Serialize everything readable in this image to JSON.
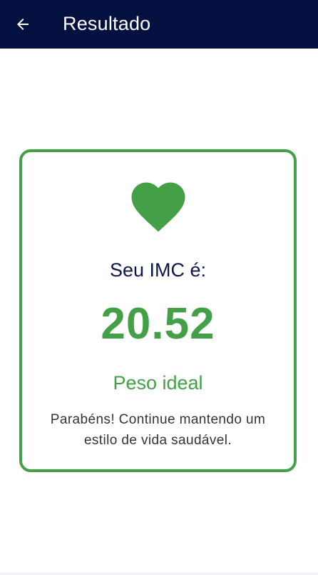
{
  "appbar": {
    "title": "Resultado",
    "back_icon": "arrow-left-icon",
    "background": "#031040"
  },
  "result": {
    "icon": "heart-icon",
    "label": "Seu IMC é:",
    "value": "20.52",
    "status": "Peso ideal",
    "message": "Parabéns! Continue mantendo um estilo de vida saudável.",
    "accent_color": "#43a047"
  }
}
